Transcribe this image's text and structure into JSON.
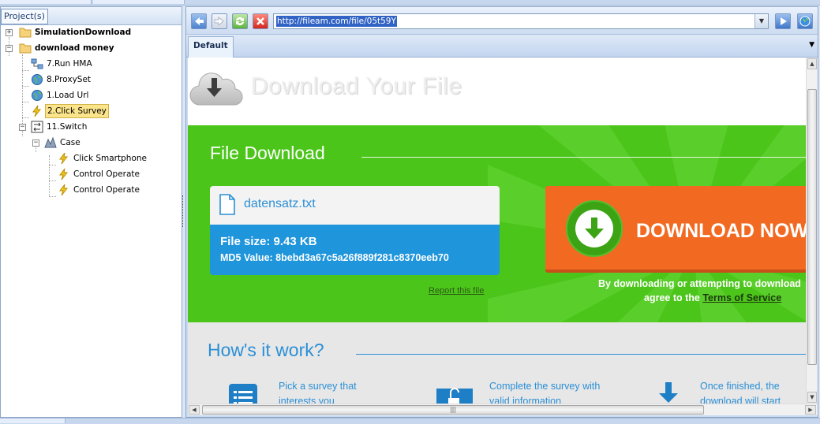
{
  "left_panel": {
    "tab_label": "Project(s)",
    "tree": [
      {
        "label": "SimulationDownload",
        "icon": "folder-icon",
        "bold": true
      },
      {
        "label": "download money",
        "icon": "folder-icon",
        "bold": true
      },
      {
        "label": "7.Run HMA",
        "icon": "network-icon"
      },
      {
        "label": "8.ProxySet",
        "icon": "globe-icon"
      },
      {
        "label": "1.Load Url",
        "icon": "globe-icon"
      },
      {
        "label": "2.Click Survey",
        "icon": "lightning-icon",
        "selected": true
      },
      {
        "label": "11.Switch",
        "icon": "switch-icon"
      },
      {
        "label": "Case",
        "icon": "case-icon"
      },
      {
        "label": "Click Smartphone",
        "icon": "lightning-icon"
      },
      {
        "label": "Control Operate",
        "icon": "lightning-icon"
      },
      {
        "label": "Control Operate",
        "icon": "lightning-icon"
      }
    ]
  },
  "browser": {
    "url": "http://fileam.com/file/05t59Y",
    "tab_label": "Default"
  },
  "page": {
    "site_title": "Download Your File",
    "heading": "File Download",
    "file_name": "datensatz.txt",
    "file_size": "File size: 9.43 KB",
    "md5": "MD5 Value: 8bebd3a67c5a26f889f281c8370eeb70",
    "report_link": "Report this file",
    "download_button": "DOWNLOAD NOW",
    "consent_line1": "By downloading or attempting to download",
    "consent_line2_prefix": "agree to the ",
    "terms_link": "Terms of Service",
    "how_title": "How's it work?",
    "steps": [
      {
        "line1": "Pick a survey that",
        "line2": "interests you"
      },
      {
        "line1": "Complete the survey with",
        "line2": "valid information"
      },
      {
        "line1": "Once finished, the",
        "line2": "download will start"
      }
    ]
  },
  "colors": {
    "green_band": "#4cc51b",
    "download_orange": "#f26a22",
    "accent_blue": "#2b8fd6"
  }
}
